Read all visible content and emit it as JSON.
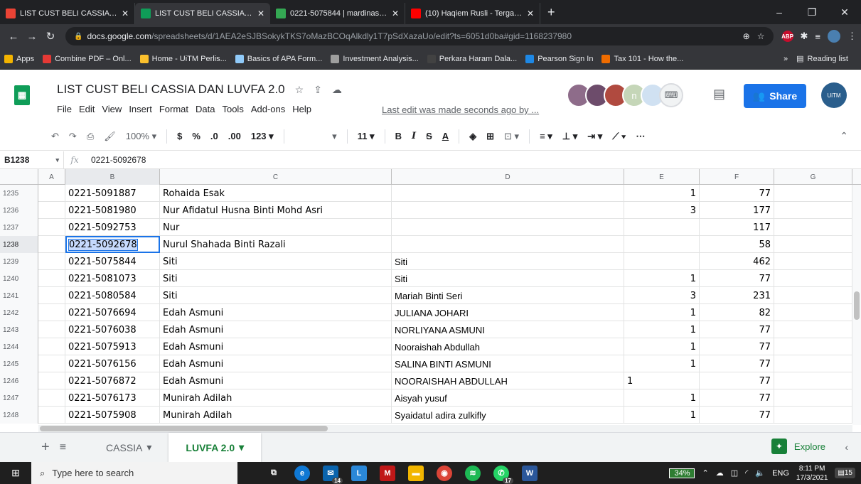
{
  "browser": {
    "tabs": [
      {
        "title": "LIST CUST BELI CASSIA DAN LUV",
        "fav": "#ea4335",
        "active": false
      },
      {
        "title": "LIST CUST BELI CASSIA DAN LUV",
        "fav": "#0f9d58",
        "active": true
      },
      {
        "title": "0221-5075844 | mardinasafiyya |",
        "fav": "#34a853",
        "active": false
      },
      {
        "title": "(10) Haqiem Rusli - Tergantu",
        "fav": "#ff0000",
        "active": false
      }
    ],
    "url_host": "docs.google.com",
    "url_path": "/spreadsheets/d/1AEA2eSJBSokykTKS7oMazBCOqAlkdly1T7pSdXazaUo/edit?ts=6051d0ba#gid=1168237980",
    "bookmarks": [
      {
        "label": "Apps",
        "color": "#f4b400"
      },
      {
        "label": "Combine PDF – Onl...",
        "color": "#e53935"
      },
      {
        "label": "Home - UiTM Perlis...",
        "color": "#fbc02d"
      },
      {
        "label": "Basics of APA Form...",
        "color": "#90caf9"
      },
      {
        "label": "Investment Analysis...",
        "color": "#9e9e9e"
      },
      {
        "label": "Perkara Haram Dala...",
        "color": "#424242"
      },
      {
        "label": "Pearson Sign In",
        "color": "#1e88e5"
      },
      {
        "label": "Tax 101 - How the...",
        "color": "#ef6c00"
      }
    ],
    "reading_list": "Reading list"
  },
  "sheet": {
    "title": "LIST CUST BELI CASSIA DAN LUVFA 2.0",
    "menu": [
      "File",
      "Edit",
      "View",
      "Insert",
      "Format",
      "Data",
      "Tools",
      "Add-ons",
      "Help"
    ],
    "last_edit": "Last edit was made seconds ago by ...",
    "share_label": "Share",
    "avatar_letter": "n",
    "toolbar": {
      "zoom": "100%",
      "currency": "$",
      "percent": "%",
      "dec_less": ".0",
      "dec_more": ".00",
      "format_more": "123",
      "font_size": "11",
      "bold": "B",
      "italic": "I",
      "strike": "S",
      "text_color": "A",
      "more": "⋯"
    },
    "name_box": "B1238",
    "formula_value": "0221-5092678",
    "columns": [
      "A",
      "B",
      "C",
      "D",
      "E",
      "F",
      "G"
    ],
    "rows": [
      {
        "n": "1235",
        "b": "0221-5091887",
        "c": "Rohaida Esak",
        "d": "",
        "e": "1",
        "f": "77"
      },
      {
        "n": "1236",
        "b": "0221-5081980",
        "c": "Nur Afidatul Husna Binti Mohd Asri",
        "d": "",
        "e": "3",
        "f": "177"
      },
      {
        "n": "1237",
        "b": "0221-5092753",
        "c": "Nur",
        "d": "",
        "e": "",
        "f": "117"
      },
      {
        "n": "1238",
        "b": "0221-5092678",
        "c": "Nurul Shahada Binti Razali",
        "d": "",
        "e": "",
        "f": "58"
      },
      {
        "n": "1239",
        "b": "0221-5075844",
        "c": "Siti",
        "d": "Siti",
        "e": "",
        "f": "462"
      },
      {
        "n": "1240",
        "b": "0221-5081073",
        "c": "Siti",
        "d": "Siti",
        "e": "1",
        "f": "77"
      },
      {
        "n": "1241",
        "b": "0221-5080584",
        "c": "Siti",
        "d": "Mariah Binti Seri",
        "e": "3",
        "f": "231"
      },
      {
        "n": "1242",
        "b": "0221-5076694",
        "c": "Edah Asmuni",
        "d": "JULIANA JOHARI",
        "e": "1",
        "f": "82"
      },
      {
        "n": "1243",
        "b": "0221-5076038",
        "c": "Edah Asmuni",
        "d": "NORLIYANA ASMUNI",
        "e": "1",
        "f": "77"
      },
      {
        "n": "1244",
        "b": "0221-5075913",
        "c": "Edah Asmuni",
        "d": "Nooraishah Abdullah",
        "e": "1",
        "f": "77"
      },
      {
        "n": "1245",
        "b": "0221-5076156",
        "c": "Edah Asmuni",
        "d": "SALINA BINTI ASMUNI",
        "e": "1",
        "f": "77"
      },
      {
        "n": "1246",
        "b": "0221-5076872",
        "c": "Edah Asmuni",
        "d": "NOORAISHAH ABDULLAH",
        "e": "1",
        "e_left": true,
        "f": "77"
      },
      {
        "n": "1247",
        "b": "0221-5076173",
        "c": "Munirah Adilah",
        "d": "Aisyah yusuf",
        "e": "1",
        "f": "77"
      },
      {
        "n": "1248",
        "b": "0221-5075908",
        "c": "Munirah Adilah",
        "d": "Syaidatul adira zulkifly",
        "e": "1",
        "f": "77"
      }
    ],
    "sheet_tabs": [
      {
        "label": "CASSIA",
        "active": false
      },
      {
        "label": "LUVFA 2.0",
        "active": true
      }
    ],
    "explore_label": "Explore"
  },
  "taskbar": {
    "search_placeholder": "Type here to search",
    "mail_badge": "14",
    "whatsapp_badge": "17",
    "battery": "34%",
    "lang": "ENG",
    "time": "8:11 PM",
    "date": "17/3/2021",
    "notif_count": "15"
  }
}
